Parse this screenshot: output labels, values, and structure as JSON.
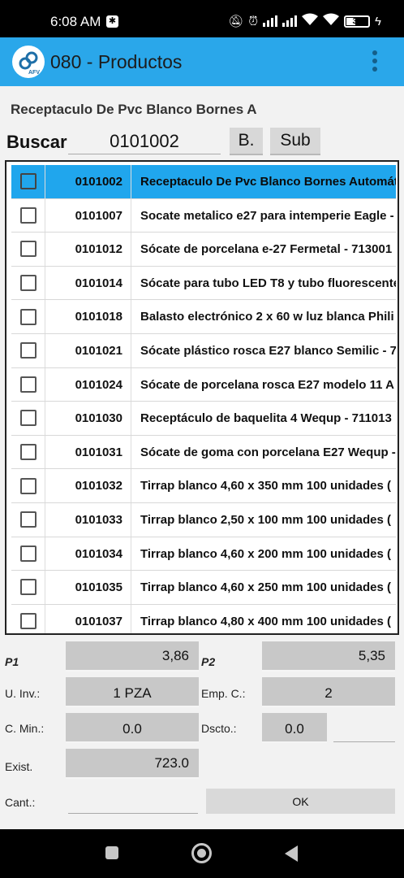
{
  "status_bar": {
    "time": "6:08 AM",
    "battery": "30"
  },
  "app_bar": {
    "title": "080 - Productos"
  },
  "selected_product": "Receptaculo De Pvc Blanco Bornes A",
  "search": {
    "label": "Buscar",
    "value": "0101002",
    "b_button": "B.",
    "sub_button": "Sub"
  },
  "products": [
    {
      "code": "0101002",
      "description": "Receptaculo De Pvc Blanco Bornes Automát",
      "selected": true
    },
    {
      "code": "0101007",
      "description": "Socate metalico e27 para intemperie Eagle -"
    },
    {
      "code": "0101012",
      "description": "Sócate de porcelana e-27 Fermetal - 713001"
    },
    {
      "code": "0101014",
      "description": "Sócate para tubo LED T8 y tubo fluorescente"
    },
    {
      "code": "0101018",
      "description": "Balasto electrónico 2 x 60 w luz blanca Phili"
    },
    {
      "code": "0101021",
      "description": "Sócate plástico rosca E27 blanco Semilic - 7"
    },
    {
      "code": "0101024",
      "description": "Sócate de porcelana rosca E27 modelo 11 A"
    },
    {
      "code": "0101030",
      "description": "Receptáculo de baquelita 4 Wequp - 711013"
    },
    {
      "code": "0101031",
      "description": "Sócate de goma con porcelana E27 Wequp -"
    },
    {
      "code": "0101032",
      "description": "Tirrap blanco 4,60 x 350 mm 100 unidades ("
    },
    {
      "code": "0101033",
      "description": "Tirrap blanco 2,50 x 100 mm 100 unidades ("
    },
    {
      "code": "0101034",
      "description": "Tirrap blanco 4,60 x 200 mm 100 unidades ("
    },
    {
      "code": "0101035",
      "description": "Tirrap blanco 4,60 x 250 mm 100 unidades ("
    },
    {
      "code": "0101037",
      "description": "Tirrap blanco 4,80 x 400 mm 100 unidades ("
    }
  ],
  "details": {
    "p1_label": "P1",
    "p1_value": "3,86",
    "p2_label": "P2",
    "p2_value": "5,35",
    "u_inv_label": "U. Inv.:",
    "u_inv_value": "1 PZA",
    "emp_c_label": "Emp. C.:",
    "emp_c_value": "2",
    "c_min_label": "C. Min.:",
    "c_min_value": "0.0",
    "dscto_label": "Dscto.:",
    "dscto_value": "0.0",
    "exist_label": "Exist.",
    "exist_value": "723.0",
    "cant_label": "Cant.:",
    "cant_value": "",
    "ok_label": "OK"
  },
  "colors": {
    "app_bar": "#2aa7ea",
    "selected_row": "#20a6ed",
    "field_bg": "#c8c8c8"
  }
}
